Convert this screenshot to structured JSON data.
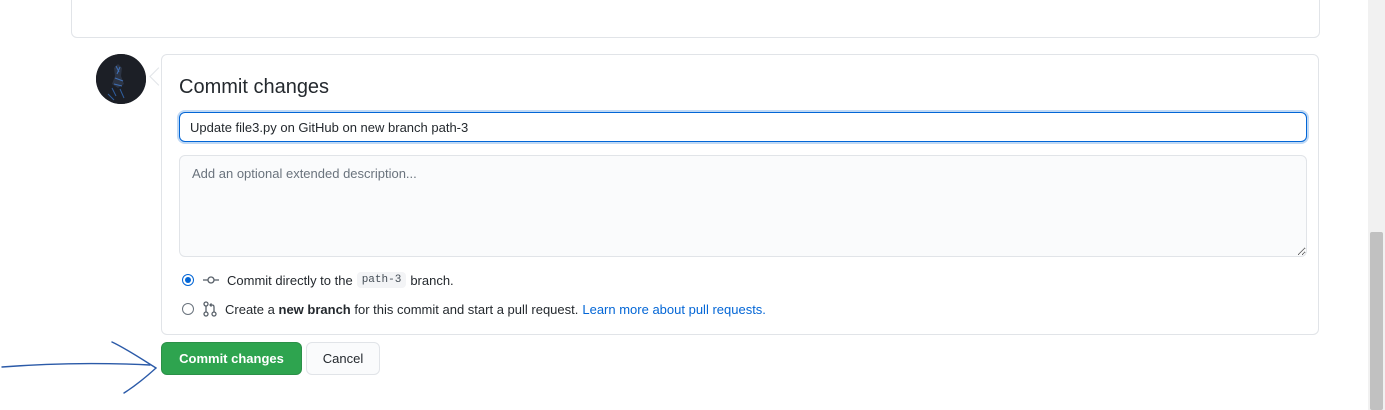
{
  "commit_form": {
    "heading": "Commit changes",
    "summary_value": "Update file3.py on GitHub on new branch path-3",
    "description_placeholder": "Add an optional extended description...",
    "option_direct": {
      "prefix": "Commit directly to the",
      "branch": "path-3",
      "suffix": "branch.",
      "selected": true,
      "icon": "git-commit-icon"
    },
    "option_new_branch": {
      "prefix": "Create a",
      "bold": "new branch",
      "suffix": "for this commit and start a pull request.",
      "link": "Learn more about pull requests.",
      "selected": false,
      "icon": "git-pull-request-icon"
    }
  },
  "buttons": {
    "commit_label": "Commit changes",
    "cancel_label": "Cancel"
  },
  "colors": {
    "primary_green": "#2ea44f",
    "focus_blue": "#0366d6",
    "annotation_ink": "#2b5aa8"
  }
}
